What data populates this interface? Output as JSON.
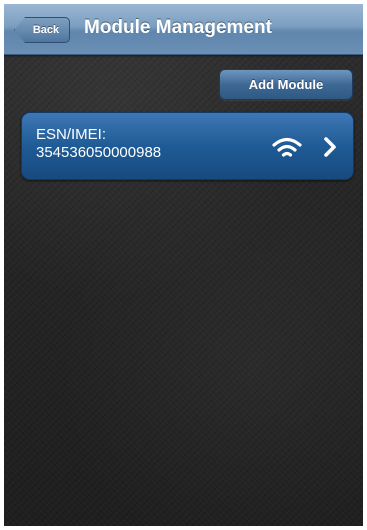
{
  "navbar": {
    "back_label": "Back",
    "title": "Module Management"
  },
  "toolbar": {
    "add_module_label": "Add Module"
  },
  "modules": [
    {
      "label": "ESN/IMEI:",
      "value": "354536050000988",
      "status_icon": "wifi-icon",
      "accessory_icon": "chevron-right-icon"
    }
  ],
  "colors": {
    "navbar": "#7b9ec0",
    "button": "#3f6995",
    "cell": "#1f5b96",
    "background": "#262627"
  }
}
